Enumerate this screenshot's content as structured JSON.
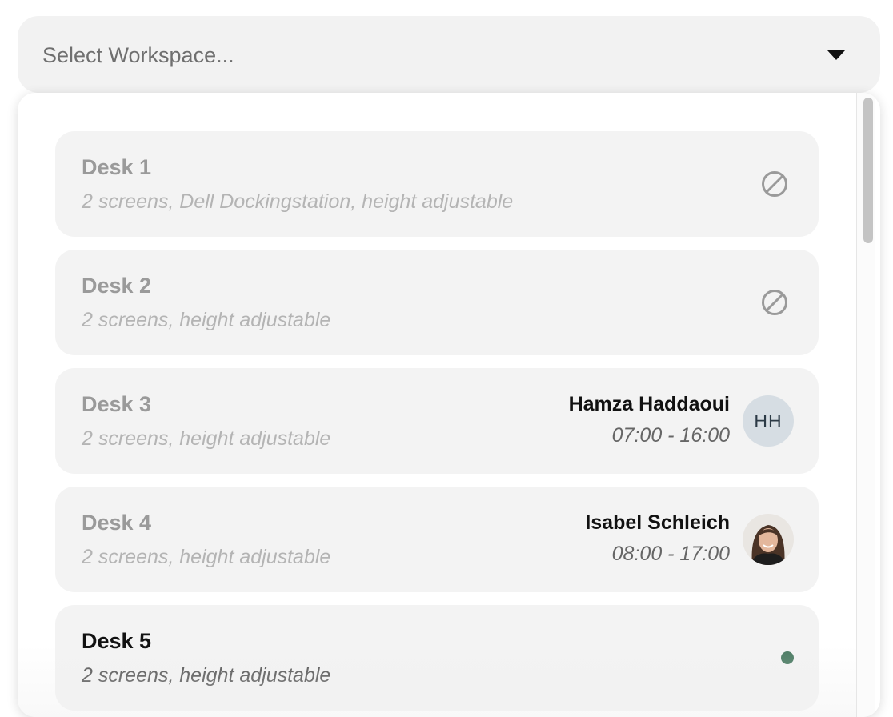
{
  "select": {
    "placeholder": "Select Workspace...",
    "icon": "caret-down-icon"
  },
  "desks": [
    {
      "name": "Desk 1",
      "description": "2 screens, Dell Dockingstation, height adjustable",
      "status": "blocked",
      "icon": "blocked-icon"
    },
    {
      "name": "Desk 2",
      "description": "2 screens, height adjustable",
      "status": "blocked",
      "icon": "blocked-icon"
    },
    {
      "name": "Desk 3",
      "description": "2 screens, height adjustable",
      "status": "booked",
      "booker": {
        "name": "Hamza Haddaoui",
        "time": "07:00 - 16:00",
        "initials": "HH"
      }
    },
    {
      "name": "Desk 4",
      "description": "2 screens, height adjustable",
      "status": "booked",
      "booker": {
        "name": "Isabel Schleich",
        "time": "08:00 - 17:00",
        "avatar": "profile-photo"
      }
    },
    {
      "name": "Desk 5",
      "description": "2 screens, height adjustable",
      "status": "available"
    }
  ],
  "colors": {
    "available_dot": "#4a7a62",
    "item_bg": "#f3f3f3",
    "blocked_icon": "#9a9a9a"
  }
}
